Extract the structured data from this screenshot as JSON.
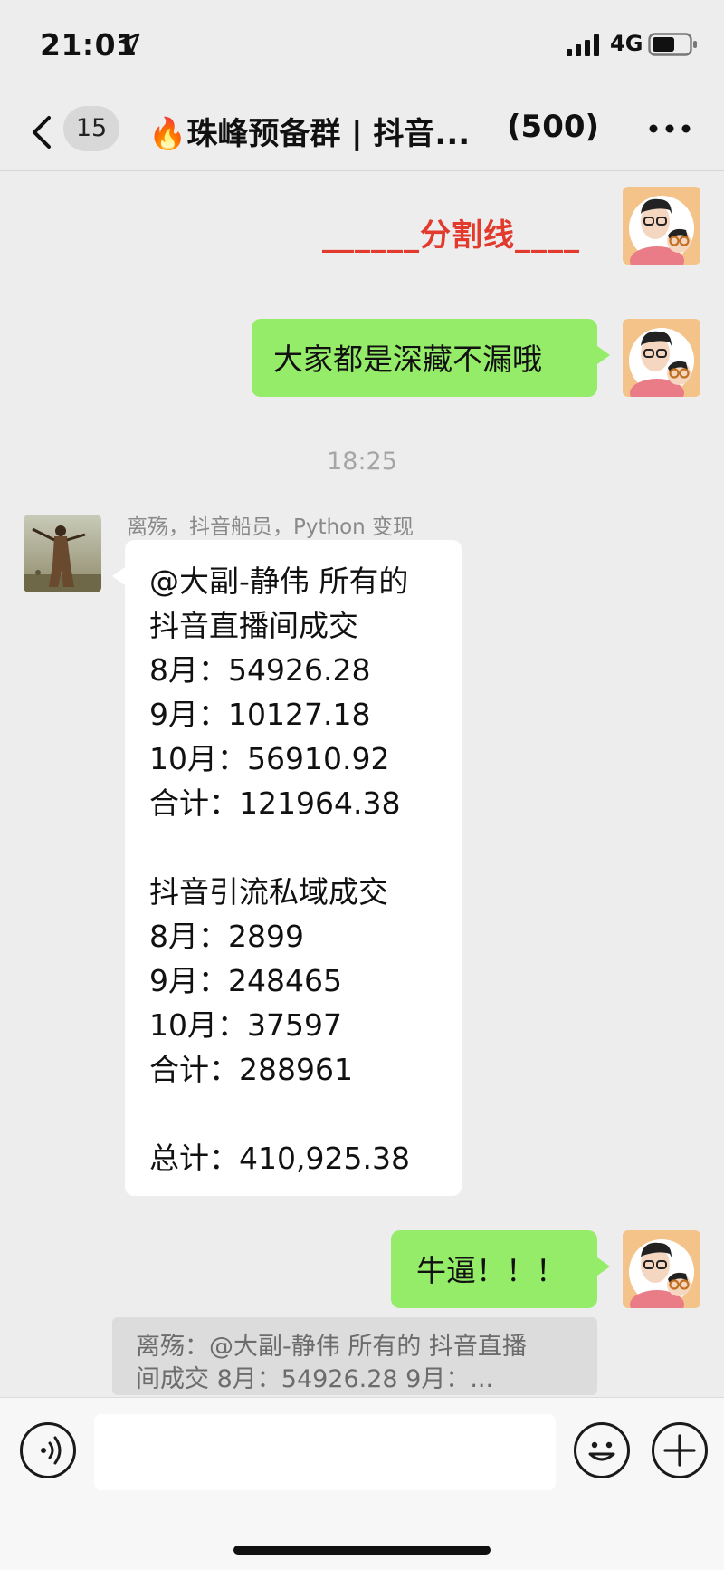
{
  "status": {
    "time": "21:01",
    "network": "4G"
  },
  "nav": {
    "unread_count": "15",
    "title": "🔥珠峰预备群 | 抖音...",
    "member_count": "(500)"
  },
  "messages": {
    "divider_text": "______分割线____",
    "green_1": "大家都是深藏不漏哦",
    "time": "18:25",
    "sender": "离殇，抖音船员，Python 变现",
    "white_lines": [
      "@大副-静伟 所有的",
      "抖音直播间成交",
      "8月：54926.28",
      "9月：10127.18",
      "10月：56910.92",
      "合计：121964.38",
      "",
      "抖音引流私域成交",
      "8月：2899",
      "9月：248465",
      "10月：37597",
      "合计：288961",
      "",
      "总计：410,925.38"
    ],
    "green_2": "牛逼！！！"
  },
  "quote": {
    "line1": "离殇：@大副-静伟 所有的 抖音直播",
    "line2": "间成交 8月：54926.28 9月：..."
  },
  "input": {
    "placeholder": ""
  },
  "colors": {
    "bubble_me": "#95ec69",
    "background": "#ededed",
    "divider": "#e23b2e"
  }
}
